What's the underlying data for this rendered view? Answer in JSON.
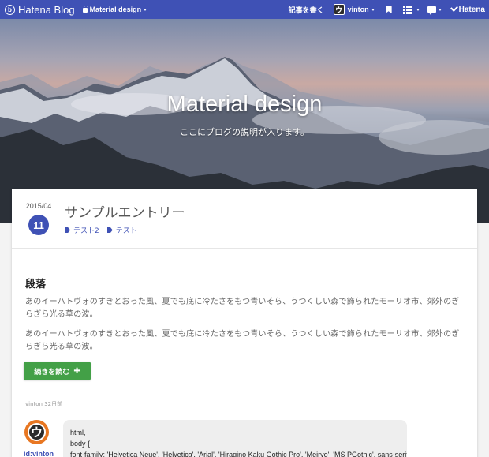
{
  "globalbar": {
    "logo_text": "Hatena Blog",
    "logo_mark": "b",
    "blog_name": "Material design",
    "write_label": "記事を書く",
    "user_name": "vinton",
    "user_avatar_glyph": "ウ",
    "hatena_label": "Hatena",
    "icons": [
      "hatena-blog-logo-icon",
      "lock-icon",
      "bookmark-icon",
      "apps-grid-icon",
      "message-icon",
      "hatena-icon"
    ],
    "accent_color": "#3f51b5"
  },
  "header": {
    "title": "Material design",
    "description": "ここにブログの説明が入ります。"
  },
  "entry": {
    "date_ym": "2015/04",
    "date_day": "11",
    "title": "サンプルエントリー",
    "categories": [
      "テスト2",
      "テスト"
    ],
    "heading": "段落",
    "paragraphs": [
      "あのイーハトヴォのすきとおった風、夏でも底に冷たさをもつ青いそら、うつくしい森で飾られたモーリオ市、郊外のぎらぎら光る草の波。",
      "あのイーハトヴォのすきとおった風、夏でも底に冷たさをもつ青いそら、うつくしい森で飾られたモーリオ市、郊外のぎらぎら光る草の波。"
    ],
    "read_more_label": "続きを読む",
    "read_more_color": "#43a047",
    "meta": "vinton 32日前"
  },
  "comment": {
    "author_id": "id:vinton",
    "avatar_glyph": "ウ",
    "lines": [
      "html,",
      "body {",
      "font-family: 'Helvetica Neue', 'Helvetica', 'Arial', 'Hiragino Kaku Gothic Pro', 'Meiryo', 'MS PGothic', sans-serif;"
    ]
  }
}
